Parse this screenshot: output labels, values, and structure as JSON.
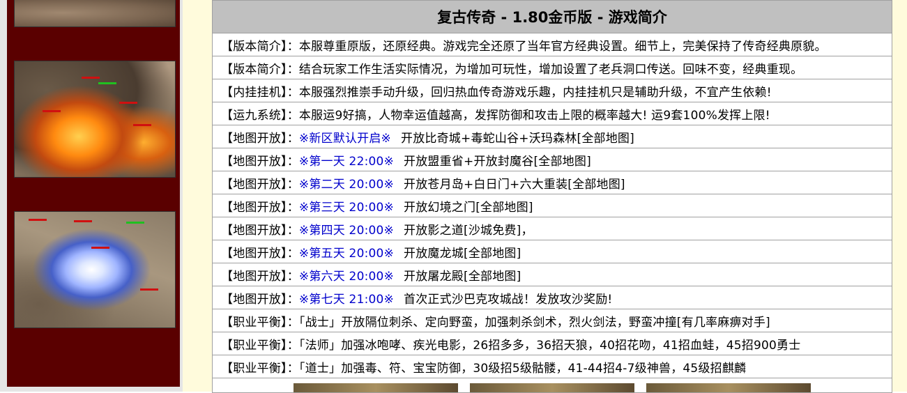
{
  "title": "复古传奇 - 1.80金币版 - 游戏简介",
  "sidebar_images": [
    {
      "icon": "game-screenshot-icon"
    },
    {
      "icon": "game-screenshot-fire-icon"
    },
    {
      "icon": "game-screenshot-lightning-icon"
    }
  ],
  "rows": [
    {
      "label": "【版本简介】：",
      "highlight": "",
      "text": "本服尊重原版，还原经典。游戏完全还原了当年官方经典设置。细节上，完美保持了传奇经典原貌。"
    },
    {
      "label": "【版本简介】：",
      "highlight": "",
      "text": "结合玩家工作生活实际情况，为增加可玩性，增加设置了老兵洞口传送。回味不变，经典重现。"
    },
    {
      "label": "【内挂挂机】：",
      "highlight": "",
      "text": "本服强烈推崇手动升级，回归热血传奇游戏乐趣，内挂挂机只是辅助升级，不宜产生依赖!"
    },
    {
      "label": "【运九系统】：",
      "highlight": "",
      "text": "本服运9好搞，人物幸运值越高，发挥防御和攻击上限的概率越大! 运9套100%发挥上限!"
    },
    {
      "label": "【地图开放】：",
      "highlight": "※新区默认开启※",
      "text": "开放比奇城+毒蛇山谷+沃玛森林[全部地图]"
    },
    {
      "label": "【地图开放】：",
      "highlight": "※第一天 22:00※",
      "text": "开放盟重省+开放封魔谷[全部地图]"
    },
    {
      "label": "【地图开放】：",
      "highlight": "※第二天 20:00※",
      "text": "开放苍月岛+白日门+六大重装[全部地图]"
    },
    {
      "label": "【地图开放】：",
      "highlight": "※第三天 20:00※",
      "text": "开放幻境之门[全部地图]"
    },
    {
      "label": "【地图开放】：",
      "highlight": "※第四天 20:00※",
      "text": "开放影之道[沙城免费]，"
    },
    {
      "label": "【地图开放】：",
      "highlight": "※第五天 20:00※",
      "text": "开放魔龙城[全部地图]"
    },
    {
      "label": "【地图开放】：",
      "highlight": "※第六天 20:00※",
      "text": "开放屠龙殿[全部地图]"
    },
    {
      "label": "【地图开放】：",
      "highlight": "※第七天 21:00※",
      "text": "首次正式沙巴克攻城战！发放攻沙奖励!"
    },
    {
      "label": "【职业平衡】：",
      "highlight": "",
      "text": "「战士」开放隔位刺杀、定向野蛮，加强刺杀剑术，烈火剑法，野蛮冲撞[有几率麻痹对手]"
    },
    {
      "label": "【职业平衡】：",
      "highlight": "",
      "text": "「法师」加强冰咆哮、疾光电影，26招多多，36招天狼，40招花吻，41招血蛙，45招900勇士"
    },
    {
      "label": "【职业平衡】：",
      "highlight": "",
      "text": "「道士」加强毒、符、宝宝防御，30级招5级骷髅，41-44招4-7级神兽，45级招麒麟"
    }
  ],
  "bottom_thumbnails": [
    {
      "icon": "thumbnail-image-icon"
    },
    {
      "icon": "thumbnail-image-icon"
    },
    {
      "icon": "thumbnail-image-icon"
    }
  ],
  "colors": {
    "sidebar": "#5a0000",
    "title_bar": "#c0c0c0",
    "highlight": "#0000cc",
    "cream": "#fffbdc"
  }
}
